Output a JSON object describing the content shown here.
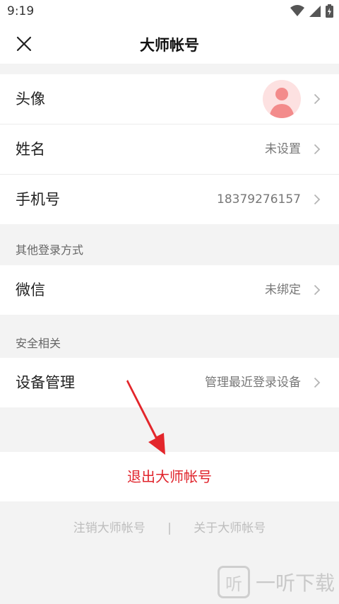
{
  "status_bar": {
    "time": "9:19",
    "icons": [
      "wifi-icon",
      "signal-icon",
      "battery-icon"
    ]
  },
  "nav": {
    "title": "大师帐号",
    "close_icon": "close-icon"
  },
  "profile": {
    "rows": [
      {
        "label": "头像",
        "value": ""
      },
      {
        "label": "姓名",
        "value": "未设置"
      },
      {
        "label": "手机号",
        "value": "18379276157"
      }
    ]
  },
  "other_login": {
    "header": "其他登录方式",
    "rows": [
      {
        "label": "微信",
        "value": "未绑定"
      }
    ]
  },
  "security": {
    "header": "安全相关",
    "rows": [
      {
        "label": "设备管理",
        "value": "管理最近登录设备"
      }
    ]
  },
  "logout_label": "退出大师帐号",
  "footer": {
    "cancel_account": "注销大师帐号",
    "separator": "|",
    "about": "关于大师帐号"
  },
  "watermark": {
    "text": "一听下载",
    "logo": "听"
  },
  "colors": {
    "accent_red": "#e0242c",
    "avatar_bg": "#fde1e1",
    "avatar_fg": "#f38b8b"
  }
}
